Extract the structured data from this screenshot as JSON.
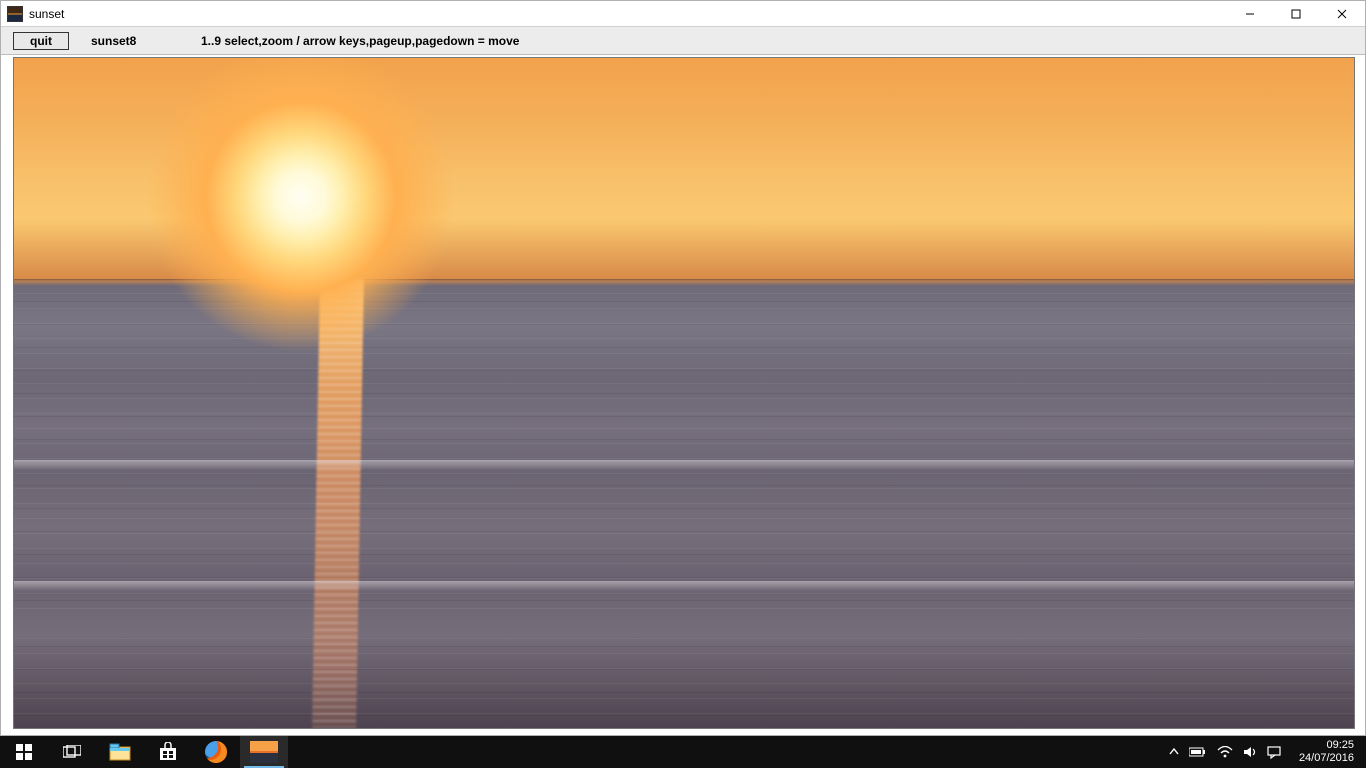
{
  "window": {
    "title": "sunset"
  },
  "toolbar": {
    "quit_label": "quit",
    "filename": "sunset8",
    "help_text": "1..9 select,zoom / arrow keys,pageup,pagedown = move"
  },
  "taskbar": {
    "clock_time": "09:25",
    "clock_date": "24/07/2016"
  }
}
